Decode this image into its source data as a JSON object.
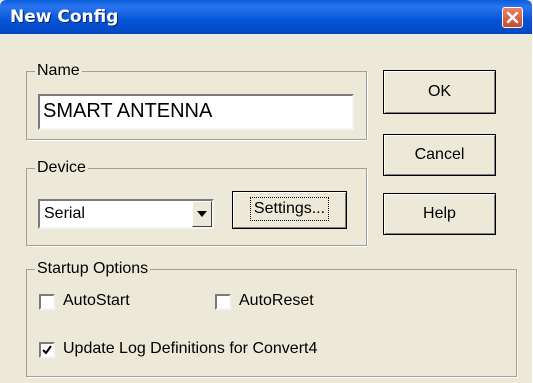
{
  "window": {
    "title": "New Config"
  },
  "name_group": {
    "legend": "Name",
    "value": "SMART ANTENNA"
  },
  "device_group": {
    "legend": "Device",
    "selected": "Serial",
    "settings_label": "Settings..."
  },
  "buttons": {
    "ok": "OK",
    "cancel": "Cancel",
    "help": "Help"
  },
  "startup": {
    "legend": "Startup Options",
    "autostart": {
      "label": "AutoStart",
      "checked": false
    },
    "autoreset": {
      "label": "AutoReset",
      "checked": false
    },
    "update_log": {
      "label": "Update Log Definitions for Convert4",
      "checked": true
    }
  },
  "colors": {
    "titlebar": "#0554d6",
    "face": "#ece9d8",
    "close": "#c84a2e"
  },
  "icons": {
    "close": "close-icon",
    "dropdown": "chevron-down-icon",
    "check": "check-icon"
  }
}
